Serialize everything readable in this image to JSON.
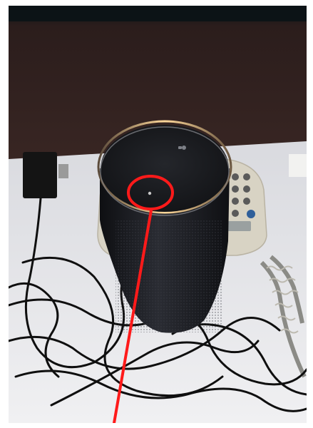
{
  "photo": {
    "subject": "smart-speaker-on-desk",
    "objects": [
      "smart-speaker",
      "desk-phone",
      "phone-handset",
      "cables",
      "power-adapter"
    ],
    "annotation": {
      "shape": "circle-with-pointer-line",
      "color": "#ff1a1a"
    },
    "colors": {
      "wall": "#2a1e1e",
      "desk": "#e6e6e8",
      "speaker_body": "#1c1d22",
      "speaker_top": "#1a1b1f",
      "light_ring": "#f0c07a",
      "phone": "#d6d2c4",
      "cable": "#111111"
    }
  }
}
